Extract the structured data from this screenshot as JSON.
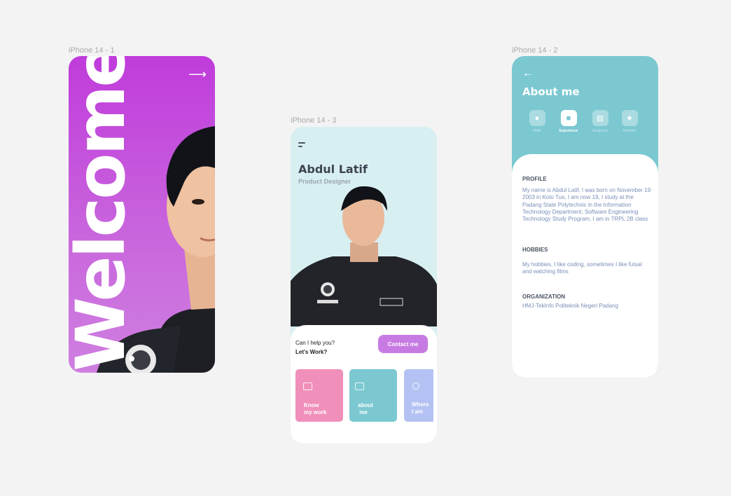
{
  "frames": {
    "phone1_label": "iPhone 14 - 1",
    "phone3_label": "iPhone 14 - 3",
    "phone2_label": "iPhone 14 - 2"
  },
  "phone1": {
    "welcome": "Welcome",
    "arrow": "⟶"
  },
  "phone3": {
    "name": "Abdul Latif",
    "role": "Product Designer",
    "help_line1": "Can I help you?",
    "help_line2": "Let's  Work?",
    "contact_label": "Contact me",
    "cards": [
      {
        "label1": "Know",
        "label2": "my work",
        "color": "#f090ba",
        "icon": "briefcase-icon"
      },
      {
        "label1": "about",
        "label2": " me",
        "color": "#7bc8d1",
        "icon": "id-card-icon"
      },
      {
        "label1": "Where",
        "label2": "I am",
        "color": "#b4c2f3",
        "icon": "location-icon"
      }
    ]
  },
  "phone2": {
    "back": "←",
    "title": "About me",
    "tabs": [
      {
        "label": "Hello",
        "icon": "user-icon"
      },
      {
        "label": "Experience",
        "icon": "briefcase-icon"
      },
      {
        "label": "Academic",
        "icon": "book-icon"
      },
      {
        "label": "Hobbies",
        "icon": "star-icon"
      }
    ],
    "profile_heading": "PROFILE",
    "profile_text": "My name is Abdul Latif, I was born on November 19 2003 in Koto Tuo, I am now 19, I study at the Padang State Polytechnic in the Information Technology Department, Software Engineering Technology Study Program, I am in TRPL 2B class",
    "hobbies_heading": "HOBBIES",
    "hobbies_text": "My hobbies, I like coding, sometimes I like futsal and watching films",
    "organization_heading": "ORGANIZATION",
    "organization_text": "HMJ-TekInfo Politeknik Negeri Padang"
  },
  "colors": {
    "background": "#f3f3f3",
    "purple": "#c03bdb",
    "teal": "#7bc8d1",
    "light_teal": "#d8eff1",
    "pink": "#f090ba",
    "lavender": "#b4c2f3",
    "button": "#c77be2"
  }
}
